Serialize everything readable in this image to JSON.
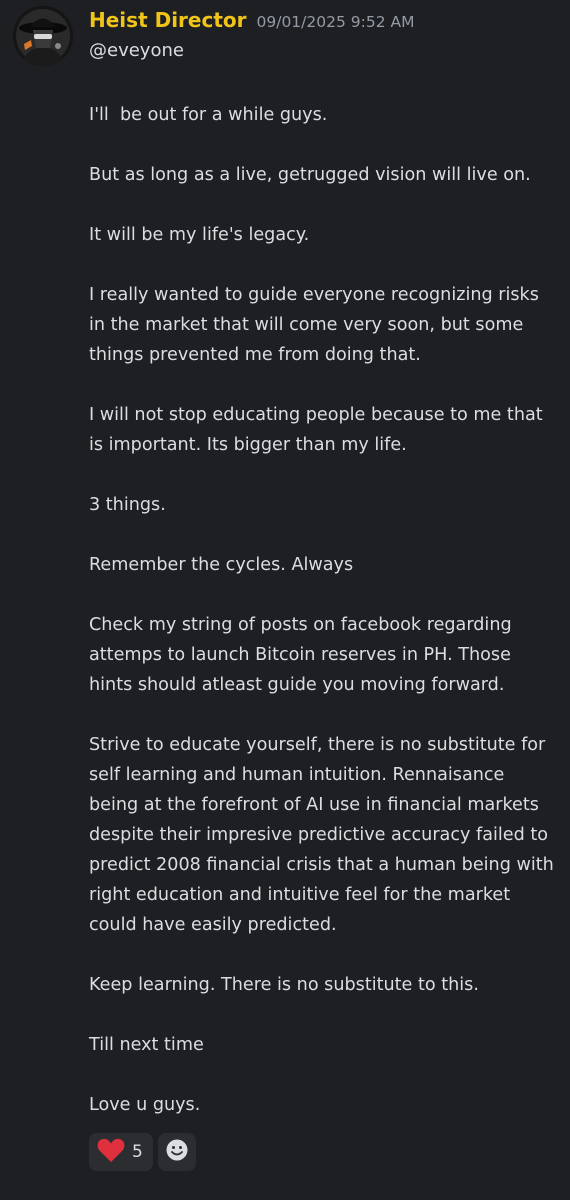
{
  "message": {
    "author": "Heist Director",
    "timestamp": "09/01/2025 9:52 AM",
    "mention": "@eveyone",
    "author_color": "#f0c419",
    "paragraphs": [
      "I'll  be out for a while guys.",
      "But as long as a live, getrugged vision will live on.",
      "It will be my life's legacy.",
      "I really wanted to guide everyone recognizing risks in the market that will come very soon, but some things prevented me from doing that.",
      "I will not stop educating people because to me that is important. Its bigger than my life.",
      "3 things.",
      "Remember the cycles. Always",
      "Check my string of posts on facebook regarding attemps to launch Bitcoin reserves in PH. Those hints should atleast guide you moving forward.",
      "Strive to educate yourself, there is no substitute for self learning and human intuition. Rennaisance being at the forefront of AI use in financial markets despite their impresive predictive accuracy failed to predict 2008 financial crisis that a human being with right education and intuitive feel for the market could have easily predicted.",
      "Keep learning. There is no substitute to this.",
      "Till next time",
      "Love u guys."
    ],
    "reactions": [
      {
        "icon": "heart-icon",
        "count": "5",
        "color": "#e0303e"
      }
    ],
    "add_reaction_icon": "smiley-add-reaction-icon"
  }
}
